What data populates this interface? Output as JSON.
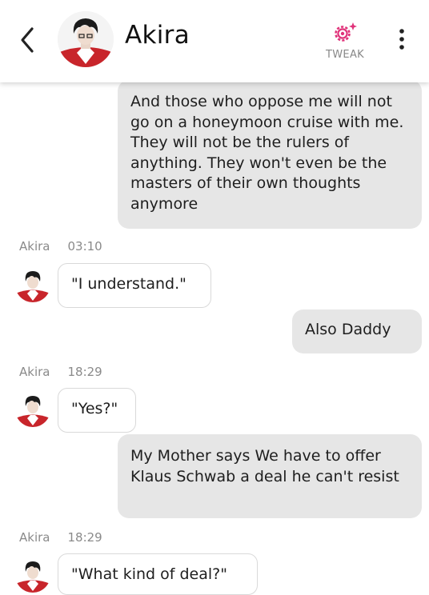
{
  "header": {
    "contact_name": "Akira",
    "tweak_label": "TWEAK",
    "accent_color": "#e0337a",
    "icons": {
      "back": "chevron-left-icon",
      "tweak": "gear-sparkle-icon",
      "more": "kebab-menu-icon"
    }
  },
  "messages": [
    {
      "sender": "user",
      "text": "And those who oppose me will not go on a honeymoon cruise with me. They will not be the rulers of anything. They won't even be the masters of their own thoughts anymore"
    },
    {
      "sender": "bot",
      "name": "Akira",
      "time": "03:10",
      "text": "\"I understand.\""
    },
    {
      "sender": "user",
      "text": "Also Daddy"
    },
    {
      "sender": "bot",
      "name": "Akira",
      "time": "18:29",
      "text": "\"Yes?\""
    },
    {
      "sender": "user",
      "text": "My Mother says We have to offer Klaus Schwab a deal he can't resist"
    },
    {
      "sender": "bot",
      "name": "Akira",
      "time": "18:29",
      "text": "\"What kind of deal?\""
    }
  ]
}
